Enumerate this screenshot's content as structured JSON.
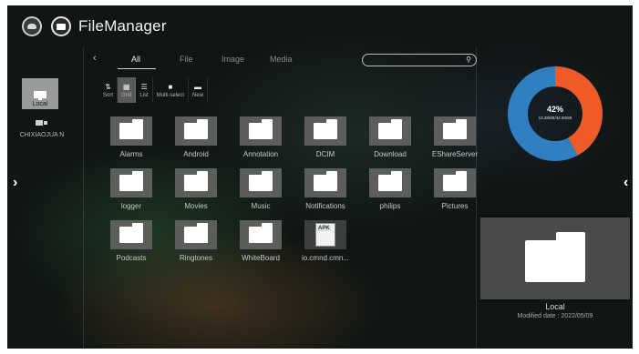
{
  "app": {
    "title": "FileManager"
  },
  "devices": [
    {
      "label": "Local",
      "icon": "monitor-icon",
      "selected": true
    },
    {
      "label": "CHIXIAOJUA N",
      "icon": "remote-device-icon",
      "selected": false
    }
  ],
  "tabs": [
    {
      "label": "All",
      "active": true
    },
    {
      "label": "File",
      "active": false
    },
    {
      "label": "Image",
      "active": false
    },
    {
      "label": "Media",
      "active": false
    }
  ],
  "search": {
    "placeholder": "",
    "value": ""
  },
  "toolbar": [
    {
      "label": "Sort",
      "icon": "sort-icon",
      "active": false
    },
    {
      "label": "Grid",
      "icon": "grid-icon",
      "active": true
    },
    {
      "label": "List",
      "icon": "list-icon",
      "active": false
    },
    {
      "label": "Multi-select",
      "icon": "multi-select-icon",
      "active": false
    },
    {
      "label": "New",
      "icon": "new-folder-icon",
      "active": false
    }
  ],
  "items": [
    {
      "name": "Alarms",
      "type": "folder"
    },
    {
      "name": "Android",
      "type": "folder"
    },
    {
      "name": "Annotation",
      "type": "folder"
    },
    {
      "name": "DCIM",
      "type": "folder"
    },
    {
      "name": "Download",
      "type": "folder"
    },
    {
      "name": "EShareServer",
      "type": "folder"
    },
    {
      "name": "logger",
      "type": "folder"
    },
    {
      "name": "Movies",
      "type": "folder"
    },
    {
      "name": "Music",
      "type": "folder"
    },
    {
      "name": "Notifications",
      "type": "folder"
    },
    {
      "name": "philips",
      "type": "folder"
    },
    {
      "name": "Pictures",
      "type": "folder"
    },
    {
      "name": "Podcasts",
      "type": "folder"
    },
    {
      "name": "Ringtones",
      "type": "folder"
    },
    {
      "name": "WhiteBoard",
      "type": "folder"
    },
    {
      "name": "io.cmnd.cmn...",
      "type": "apk",
      "badge": "APK"
    }
  ],
  "storage": {
    "percent_label": "42%",
    "detail": "13.38GB/32.00GB",
    "used_fraction": 0.42,
    "colors": {
      "used": "#f05a28",
      "free": "#2f7fc1"
    }
  },
  "preview": {
    "name": "Local",
    "modified": "Modified date : 2022/05/09"
  }
}
